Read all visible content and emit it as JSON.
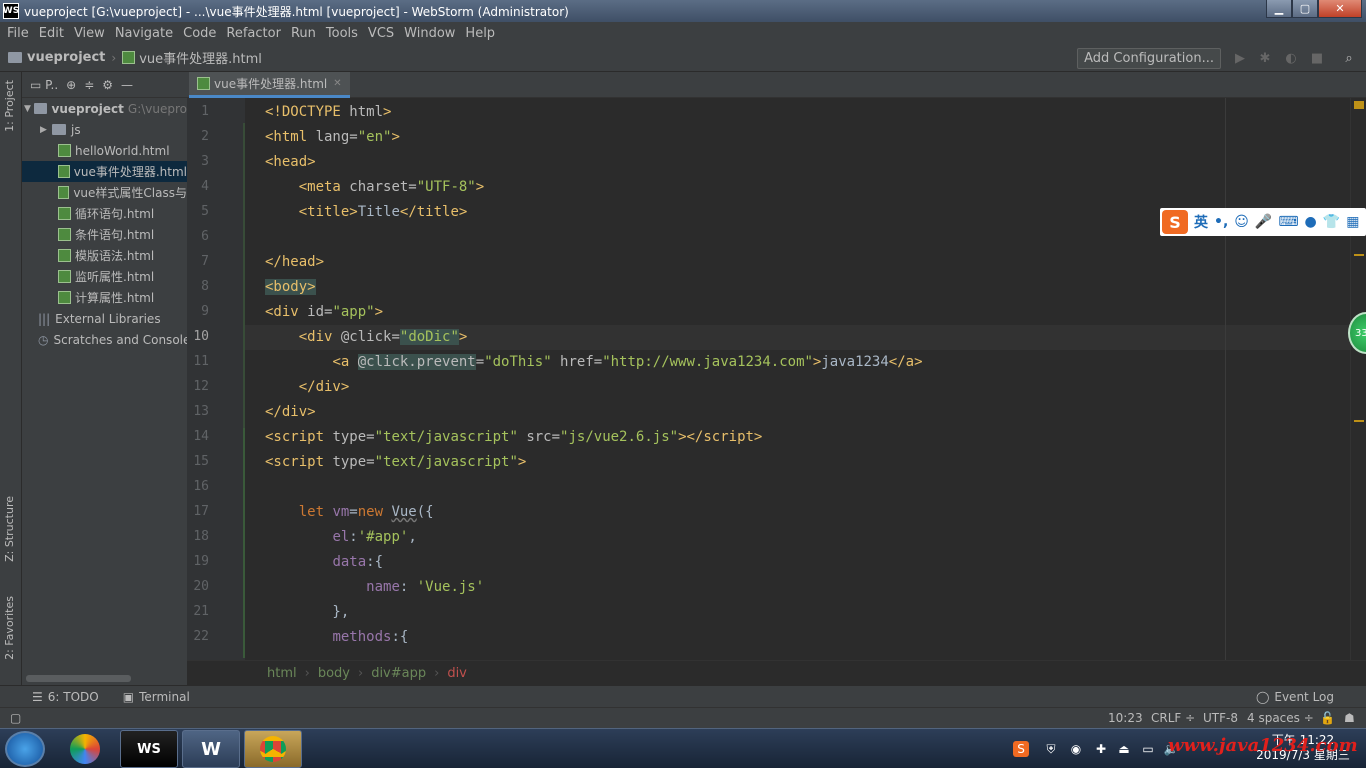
{
  "window": {
    "title": "vueproject [G:\\vueproject] - ...\\vue事件处理器.html [vueproject] - WebStorm (Administrator)"
  },
  "menu": [
    "File",
    "Edit",
    "View",
    "Navigate",
    "Code",
    "Refactor",
    "Run",
    "Tools",
    "VCS",
    "Window",
    "Help"
  ],
  "nav": {
    "project": "vueproject",
    "file": "vue事件处理器.html",
    "add_config": "Add Configuration..."
  },
  "sidebar_tabs": {
    "project": "1: Project",
    "structure": "Z: Structure",
    "favorites": "2: Favorites"
  },
  "project_panel": {
    "header": "P..",
    "root": {
      "name": "vueproject",
      "path": "G:\\vuepro"
    },
    "items": [
      "js",
      "helloWorld.html",
      "vue事件处理器.html",
      "vue样式属性Class与",
      "循环语句.html",
      "条件语句.html",
      "模版语法.html",
      "监听属性.html",
      "计算属性.html"
    ],
    "external": "External Libraries",
    "scratches": "Scratches and Console"
  },
  "editor": {
    "tab": "vue事件处理器.html",
    "line_numbers": [
      "1",
      "2",
      "3",
      "4",
      "5",
      "6",
      "7",
      "8",
      "9",
      "10",
      "11",
      "12",
      "13",
      "14",
      "15",
      "16",
      "17",
      "18",
      "19",
      "20",
      "21",
      "22"
    ]
  },
  "breadcrumb": [
    "html",
    "body",
    "div#app",
    "div"
  ],
  "bottom_tabs": {
    "todo": "6: TODO",
    "terminal": "Terminal",
    "event_log": "Event Log"
  },
  "status": {
    "position": "10:23",
    "line_sep": "CRLF ÷",
    "encoding": "UTF-8",
    "indent": "4 spaces ÷"
  },
  "taskbar": {
    "ws_label": "WS",
    "clock_time": "下午 11:22",
    "clock_date": "2019/7/3 星期三",
    "watermark": "www.java1234.com"
  },
  "ime": {
    "lang": "英"
  },
  "badge": {
    "count": "33"
  },
  "colors": {
    "tag": "#e8bf6a",
    "string": "#a5c25c",
    "keyword": "#cc7832",
    "selection": "#0d293e"
  }
}
